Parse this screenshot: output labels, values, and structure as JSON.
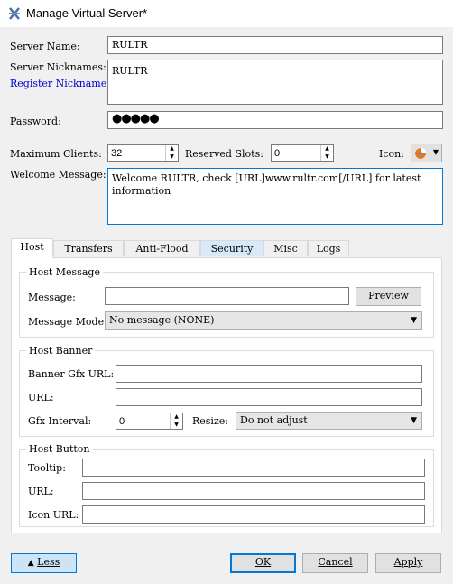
{
  "window": {
    "title": "Manage Virtual Server*"
  },
  "form": {
    "server_name_label": "Server Name:",
    "server_name_value": "RULTR",
    "nicknames_label": "Server Nicknames:",
    "register_link": "Register Nickname",
    "nicknames_value": "RULTR",
    "password_label": "Password:",
    "password_value": "●●●●●",
    "max_clients_label": "Maximum Clients:",
    "max_clients_value": "32",
    "reserved_label": "Reserved Slots:",
    "reserved_value": "0",
    "icon_label": "Icon:",
    "welcome_label": "Welcome Message:",
    "welcome_value": "Welcome RULTR, check [URL]www.rultr.com[/URL] for latest information"
  },
  "tabs": [
    {
      "label": "Host"
    },
    {
      "label": "Transfers"
    },
    {
      "label": "Anti-Flood"
    },
    {
      "label": "Security"
    },
    {
      "label": "Misc"
    },
    {
      "label": "Logs"
    }
  ],
  "host_message": {
    "group_title": "Host Message",
    "message_label": "Message:",
    "message_value": "",
    "preview_button": "Preview",
    "mode_label": "Message Mode:",
    "mode_value": "No message (NONE)"
  },
  "host_banner": {
    "group_title": "Host Banner",
    "gfx_url_label": "Banner Gfx URL:",
    "url_label": "URL:",
    "interval_label": "Gfx Interval:",
    "interval_value": "0",
    "resize_label": "Resize:",
    "resize_value": "Do not adjust"
  },
  "host_button": {
    "group_title": "Host Button",
    "tooltip_label": "Tooltip:",
    "url_label": "URL:",
    "icon_url_label": "Icon URL:"
  },
  "footer": {
    "less_button": "Less",
    "ok_button": "OK",
    "cancel_button": "Cancel",
    "apply_button": "Apply"
  }
}
